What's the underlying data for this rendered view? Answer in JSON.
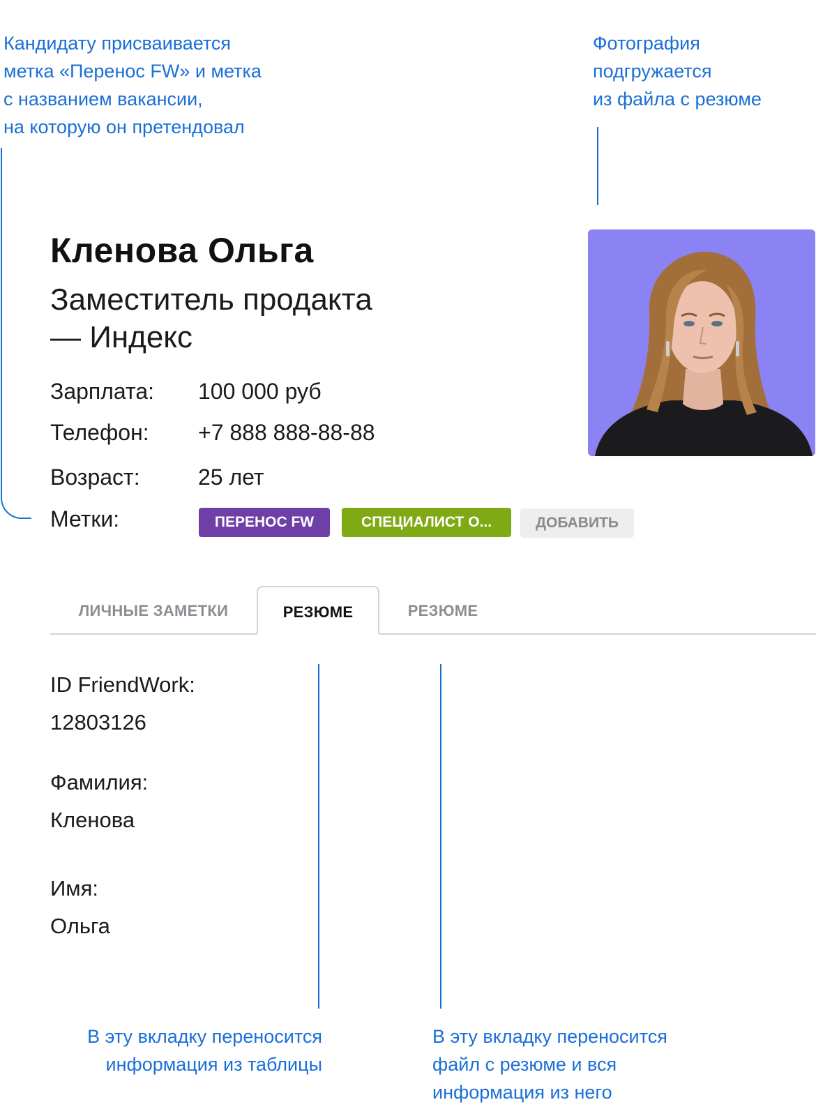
{
  "annotations": {
    "tags_note": [
      "Кандидату присваивается",
      "метка «Перенос FW» и метка",
      "с названием вакансии,",
      "на которую он претендовал"
    ],
    "photo_note": [
      "Фотография",
      "подгружается",
      "из файла с резюме"
    ],
    "table_note": [
      "В эту вкладку переносится",
      "информация из таблицы"
    ],
    "file_note": [
      "В эту вкладку переносится",
      "файл с резюме и вся",
      "информация из него"
    ]
  },
  "candidate": {
    "name": "Кленова Ольга",
    "position_line1": "Заместитель продакта",
    "position_line2": "— Индекс",
    "fields": {
      "salary_label": "Зарплата:",
      "salary_value": "100 000 руб",
      "phone_label": "Телефон:",
      "phone_value": "+7 888 888-88-88",
      "age_label": "Возраст:",
      "age_value": "25 лет",
      "tags_label": "Метки:"
    },
    "tags": [
      {
        "label": "ПЕРЕНОС FW",
        "color": "#6f3fa8"
      },
      {
        "label": "СПЕЦИАЛИСТ О...",
        "color": "#80a916"
      }
    ],
    "add_tag_label": "ДОБАВИТЬ",
    "photo_background": "#8b82f4"
  },
  "tabs": [
    {
      "label": "ЛИЧНЫЕ ЗАМЕТКИ",
      "active": false
    },
    {
      "label": "РЕЗЮМЕ",
      "active": true
    },
    {
      "label": "РЕЗЮМЕ",
      "active": false
    }
  ],
  "resume_info": {
    "id_label": "ID FriendWork:",
    "id_value": "12803126",
    "surname_label": "Фамилия:",
    "surname_value": "Кленова",
    "first_name_label": "Имя:",
    "first_name_value": "Ольга"
  },
  "colors": {
    "annotation_blue": "#1a6fd6",
    "tab_border": "#cfd3d6"
  }
}
